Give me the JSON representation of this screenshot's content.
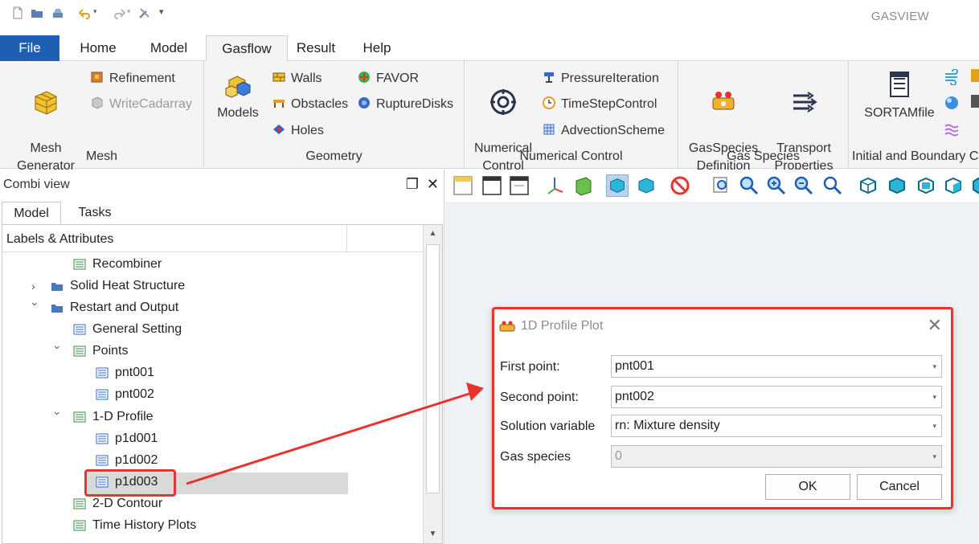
{
  "app": {
    "title": "GASVIEW"
  },
  "menu": {
    "tabs": [
      "File",
      "Home",
      "Model",
      "Gasflow",
      "Result",
      "Help"
    ],
    "active": "Gasflow"
  },
  "ribbon": {
    "mesh": {
      "label": "Mesh",
      "generator": "Mesh\nGenerator",
      "refinement": "Refinement",
      "writecadarray": "WriteCadarray"
    },
    "geometry": {
      "label": "Geometry",
      "models": "Models",
      "walls": "Walls",
      "obstacles": "Obstacles",
      "holes": "Holes",
      "favor": "FAVOR",
      "rupturedisks": "RuptureDisks"
    },
    "numerical": {
      "label": "Numerical Control",
      "numerical_control": "Numerical\nControl",
      "pressure_iteration": "PressureIteration",
      "timestep_control": "TimeStepControl",
      "advection_scheme": "AdvectionScheme"
    },
    "gas_species": {
      "label": "Gas Species",
      "definition": "GasSpecies\nDefinition",
      "transport": "Transport\nProperties"
    },
    "initial": {
      "label": "Initial and Boundary C",
      "sortam": "SORTAMfile"
    }
  },
  "panel": {
    "title": "Combi view",
    "tabs": [
      "Model",
      "Tasks"
    ],
    "tree_header": "Labels & Attributes",
    "tree": [
      {
        "label": "Recombiner"
      },
      {
        "label": "Solid Heat Structure"
      },
      {
        "label": "Restart and Output"
      },
      {
        "label": "General Setting"
      },
      {
        "label": "Points"
      },
      {
        "label": "pnt001"
      },
      {
        "label": "pnt002"
      },
      {
        "label": "1-D Profile"
      },
      {
        "label": "p1d001"
      },
      {
        "label": "p1d002"
      },
      {
        "label": "p1d003"
      },
      {
        "label": "2-D Contour"
      },
      {
        "label": "Time History Plots"
      }
    ]
  },
  "dialog": {
    "title": "1D Profile Plot",
    "first_point_label": "First point:",
    "first_point_value": "pnt001",
    "second_point_label": "Second point:",
    "second_point_value": "pnt002",
    "solution_variable_label": "Solution variable",
    "solution_variable_value": "rn: Mixture density",
    "gas_species_label": "Gas species",
    "gas_species_value": "0",
    "ok": "OK",
    "cancel": "Cancel"
  },
  "colors": {
    "accent": "#1e5fb4",
    "highlight": "#e8342c"
  }
}
